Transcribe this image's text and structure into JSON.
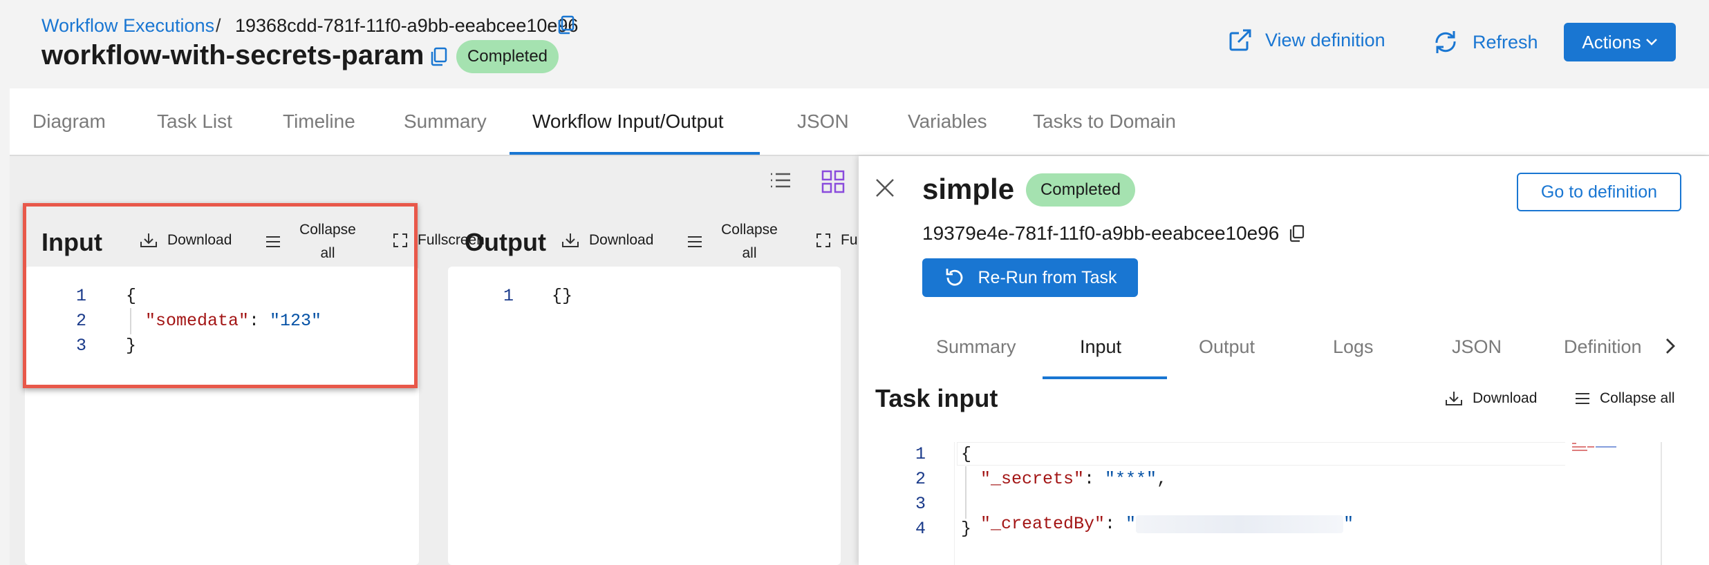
{
  "breadcrumb": {
    "link": "Workflow Executions",
    "separator": "/",
    "execution_id": "19368cdd-781f-11f0-a9bb-eeabcee10e96"
  },
  "workflow": {
    "name": "workflow-with-secrets-param",
    "status": "Completed"
  },
  "header_actions": {
    "view_definition": "View definition",
    "refresh": "Refresh",
    "actions": "Actions"
  },
  "tabs": [
    "Diagram",
    "Task List",
    "Timeline",
    "Summary",
    "Workflow Input/Output",
    "JSON",
    "Variables",
    "Tasks to Domain"
  ],
  "active_tab": "Workflow Input/Output",
  "input_panel": {
    "title": "Input",
    "download": "Download",
    "collapse_line1": "Collapse",
    "collapse_line2": "all",
    "fullscreen": "Fullscreen",
    "lines": [
      {
        "n": "1",
        "text": "{"
      },
      {
        "n": "2",
        "key": "\"somedata\"",
        "sep": ": ",
        "value": "\"123\""
      },
      {
        "n": "3",
        "text": "}"
      }
    ]
  },
  "output_panel": {
    "title": "Output",
    "download": "Download",
    "collapse_line1": "Collapse",
    "collapse_line2": "all",
    "fullscreen": "Fu",
    "lines": [
      {
        "n": "1",
        "text": "{}"
      }
    ]
  },
  "drawer": {
    "task_name": "simple",
    "status": "Completed",
    "go_to_definition": "Go to definition",
    "task_id": "19379e4e-781f-11f0-a9bb-eeabcee10e96",
    "rerun": "Re-Run from Task",
    "tabs": [
      "Summary",
      "Input",
      "Output",
      "Logs",
      "JSON",
      "Definition"
    ],
    "active_tab": "Input",
    "section_title": "Task input",
    "download": "Download",
    "collapse_all": "Collapse all",
    "lines": [
      {
        "n": "1",
        "text": "{"
      },
      {
        "n": "2",
        "key": "\"_secrets\"",
        "sep": ": ",
        "value": "\"***\"",
        "trail": ","
      },
      {
        "n": "3",
        "key": "\"_createdBy\"",
        "sep": ": ",
        "value_open": "\"",
        "value_close": "\""
      },
      {
        "n": "4",
        "text": "}"
      }
    ]
  },
  "colors": {
    "accent": "#1976d2",
    "status_badge": "#a5e2b0",
    "highlight": "#e8584a",
    "json_key": "#a31515",
    "json_value": "#0451a5"
  }
}
